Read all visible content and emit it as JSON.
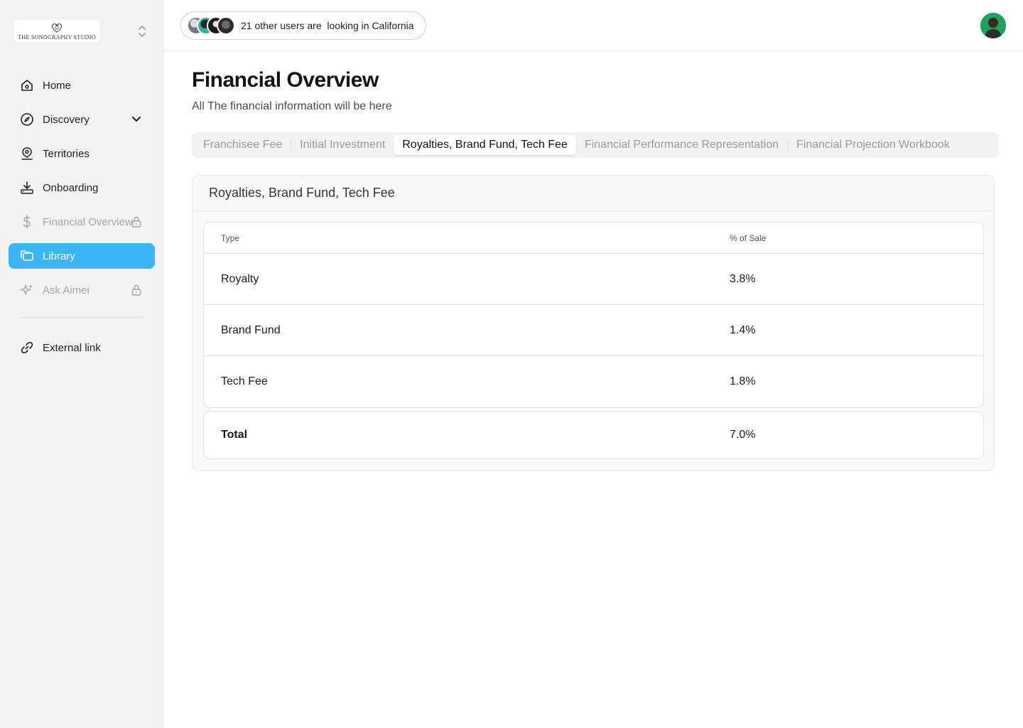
{
  "brand": {
    "name": "THE SONOGRAPHY STUDIO"
  },
  "sidebar": {
    "items": [
      {
        "label": "Home",
        "icon": "home-icon",
        "state": "normal"
      },
      {
        "label": "Discovery",
        "icon": "compass-icon",
        "state": "normal",
        "trailing": "chevron-down-icon"
      },
      {
        "label": "Territories",
        "icon": "map-pin-user-icon",
        "state": "normal"
      },
      {
        "label": "Onboarding",
        "icon": "download-tray-icon",
        "state": "normal"
      },
      {
        "label": "Financial Overview",
        "icon": "dollar-icon",
        "state": "locked",
        "trailing": "lock-icon"
      },
      {
        "label": "Library",
        "icon": "folders-icon",
        "state": "active"
      },
      {
        "label": "Ask Aimei",
        "icon": "sparkle-icon",
        "state": "locked",
        "trailing": "lock-icon"
      }
    ],
    "external": {
      "label": "External link",
      "icon": "link-icon"
    }
  },
  "topbar": {
    "presence_text": "21 other users are  looking in California"
  },
  "page": {
    "title": "Financial Overview",
    "subtitle": "All The financial information will be here"
  },
  "tabs": [
    {
      "label": "Franchisee Fee",
      "active": false
    },
    {
      "label": "Initial Investment",
      "active": false
    },
    {
      "label": "Royalties, Brand Fund, Tech Fee",
      "active": true
    },
    {
      "label": "Financial Performance Representation",
      "active": false
    },
    {
      "label": "Financial Projection Workbook",
      "active": false
    }
  ],
  "card": {
    "title": "Royalties, Brand Fund, Tech Fee",
    "table": {
      "headers": [
        "Type",
        "% of Sale"
      ],
      "rows": [
        [
          "Royalty",
          "3.8%"
        ],
        [
          "Brand Fund",
          "1.4%"
        ],
        [
          "Tech Fee",
          "1.8%"
        ]
      ]
    },
    "total": {
      "label": "Total",
      "value": "7.0%"
    }
  },
  "colors": {
    "accent": "#38b6f5",
    "avatar_bg": "#1fa35a"
  }
}
